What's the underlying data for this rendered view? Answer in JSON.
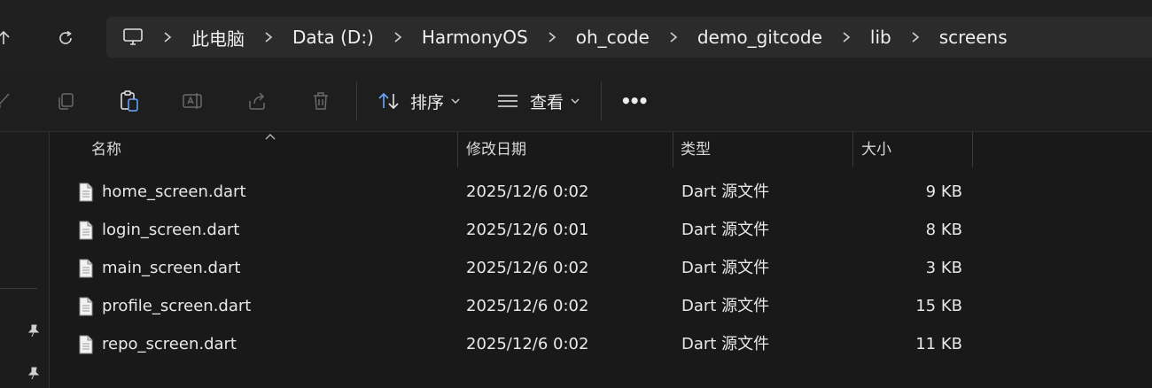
{
  "address": {
    "crumbs": [
      "此电脑",
      "Data (D:)",
      "HarmonyOS",
      "oh_code",
      "demo_gitcode",
      "lib",
      "screens"
    ]
  },
  "toolbar": {
    "sort_label": "排序",
    "view_label": "查看",
    "more_label": "•••"
  },
  "columns": {
    "name": "名称",
    "modified": "修改日期",
    "type": "类型",
    "size": "大小"
  },
  "files": [
    {
      "name": "home_screen.dart",
      "modified": "2025/12/6 0:02",
      "type": "Dart 源文件",
      "size": "9 KB"
    },
    {
      "name": "login_screen.dart",
      "modified": "2025/12/6 0:01",
      "type": "Dart 源文件",
      "size": "8 KB"
    },
    {
      "name": "main_screen.dart",
      "modified": "2025/12/6 0:02",
      "type": "Dart 源文件",
      "size": "3 KB"
    },
    {
      "name": "profile_screen.dart",
      "modified": "2025/12/6 0:02",
      "type": "Dart 源文件",
      "size": "15 KB"
    },
    {
      "name": "repo_screen.dart",
      "modified": "2025/12/6 0:02",
      "type": "Dart 源文件",
      "size": "11 KB"
    }
  ],
  "colors": {
    "background": "#191919",
    "toolbar": "#1e1e1e",
    "address_bg": "#2b2b2b",
    "sort_icon_accent": "#6aa9ff"
  }
}
